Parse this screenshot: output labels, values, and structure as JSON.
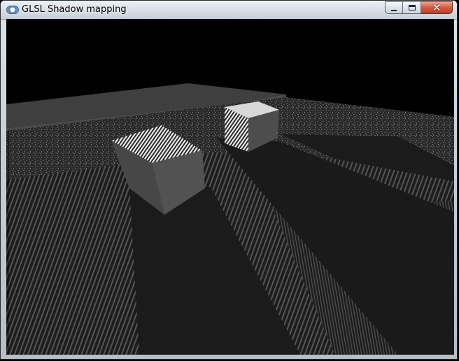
{
  "window": {
    "title": "GLSL Shadow mapping",
    "icons": {
      "app": "opengl-window-icon",
      "minimize": "minimize-icon",
      "maximize": "maximize-icon",
      "close": "close-icon"
    }
  },
  "scene": {
    "description_objects": [
      "floor",
      "back-wall",
      "left-cube",
      "right-cube",
      "shadows"
    ]
  },
  "colors": {
    "background": "#000000",
    "floor": "#1a1a1a",
    "wall": "#444444",
    "cube_side": "#4a4a4a",
    "cube_top": "#8a8a8a",
    "close_button": "#c9482c"
  }
}
